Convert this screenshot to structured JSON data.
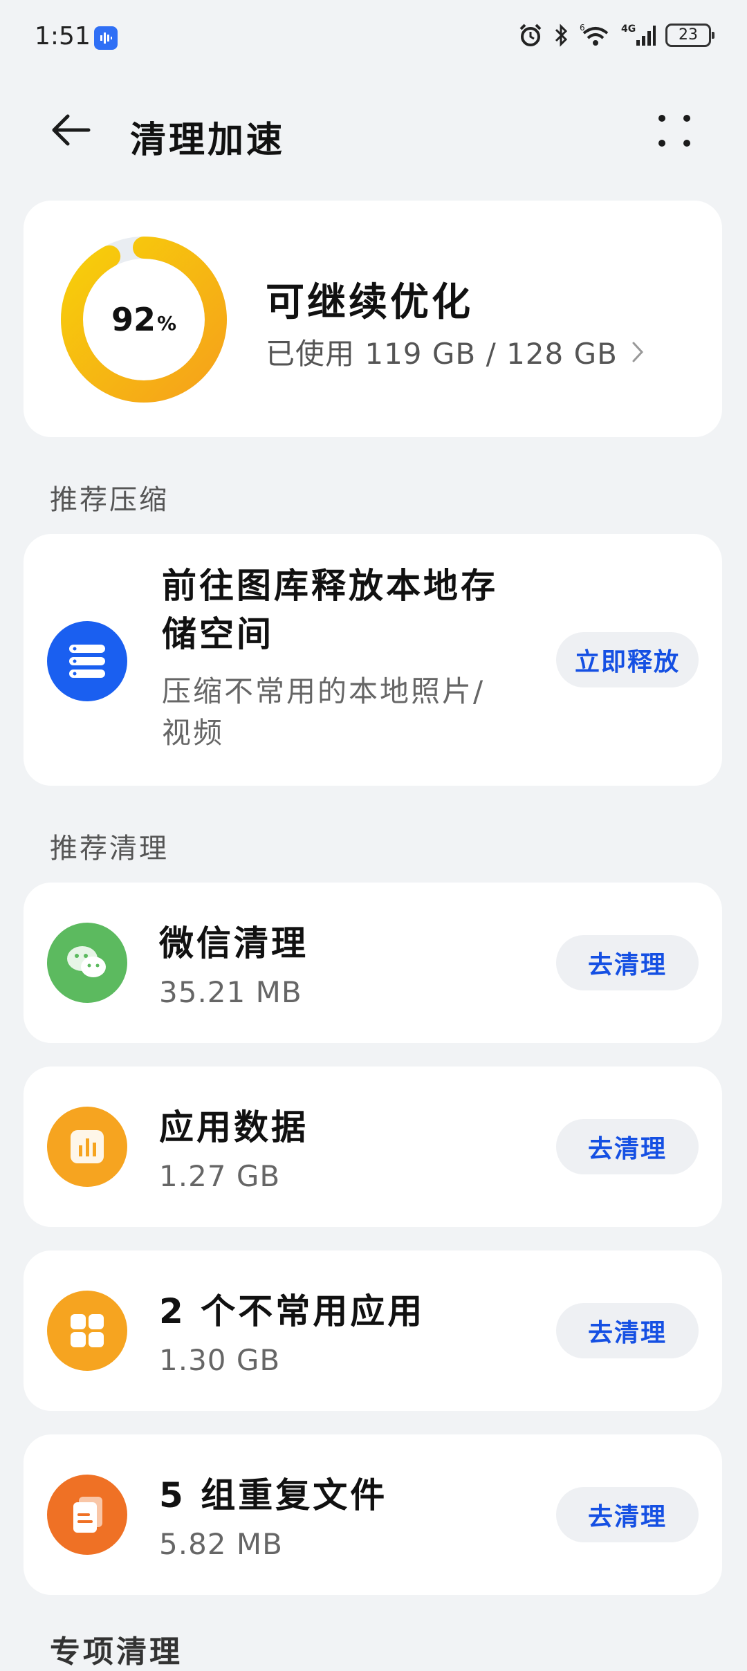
{
  "status": {
    "time": "1:51",
    "battery": "23"
  },
  "header": {
    "title": "清理加速"
  },
  "storage": {
    "percent": "92",
    "percent_unit": "%",
    "percent_value": 0.92,
    "title": "可继续优化",
    "usage": "已使用 119 GB / 128 GB"
  },
  "sections": {
    "compress_header": "推荐压缩",
    "clean_header": "推荐清理",
    "special_header": "专项清理"
  },
  "compress": {
    "title": "前往图库释放本地存储空间",
    "desc": "压缩不常用的本地照片/视频",
    "button": "立即释放"
  },
  "clean_items": [
    {
      "title": "微信清理",
      "size": "35.21 MB",
      "button": "去清理",
      "icon": "wechat-icon"
    },
    {
      "title": "应用数据",
      "size": "1.27 GB",
      "button": "去清理",
      "icon": "app-data-icon"
    },
    {
      "title": "2 个不常用应用",
      "size": "1.30 GB",
      "button": "去清理",
      "icon": "apps-grid-icon"
    },
    {
      "title": "5 组重复文件",
      "size": "5.82 MB",
      "button": "去清理",
      "icon": "duplicate-files-icon"
    }
  ],
  "colors": {
    "accent": "#1550e3",
    "ring_start": "#f6a21a",
    "ring_end": "#f7cf0a",
    "ring_track": "#e9edf2"
  }
}
